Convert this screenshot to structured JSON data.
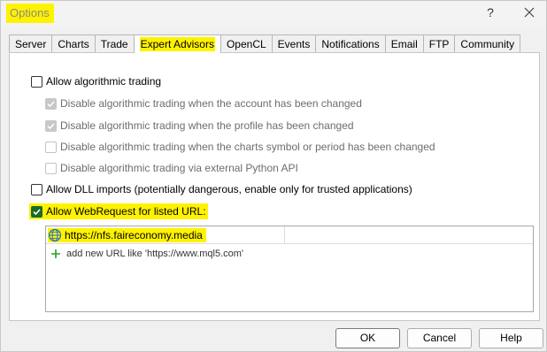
{
  "window": {
    "title": "Options",
    "help_glyph": "?",
    "close_icon": "close-icon"
  },
  "tabs": [
    {
      "label": "Server",
      "active": false
    },
    {
      "label": "Charts",
      "active": false
    },
    {
      "label": "Trade",
      "active": false
    },
    {
      "label": "Expert Advisors",
      "active": true
    },
    {
      "label": "OpenCL",
      "active": false
    },
    {
      "label": "Events",
      "active": false
    },
    {
      "label": "Notifications",
      "active": false
    },
    {
      "label": "Email",
      "active": false
    },
    {
      "label": "FTP",
      "active": false
    },
    {
      "label": "Community",
      "active": false
    }
  ],
  "options": {
    "allow_algo": {
      "label": "Allow algorithmic trading",
      "checked": false
    },
    "disable_account": {
      "label": "Disable algorithmic trading when the account has been changed",
      "checked": true,
      "disabled": true
    },
    "disable_profile": {
      "label": "Disable algorithmic trading when the profile has been changed",
      "checked": true,
      "disabled": true
    },
    "disable_symbol": {
      "label": "Disable algorithmic trading when the charts symbol or period has been changed",
      "checked": false,
      "disabled": true
    },
    "disable_python": {
      "label": "Disable algorithmic trading via external Python API",
      "checked": false,
      "disabled": true
    },
    "allow_dll": {
      "label": "Allow DLL imports (potentially dangerous, enable only for trusted applications)",
      "checked": false
    },
    "allow_webrequest": {
      "label": "Allow WebRequest for listed URL:",
      "checked": true
    }
  },
  "url_list": {
    "urls": [
      "https://nfs.faireconomy.media"
    ],
    "add_hint": "add new URL like 'https://www.mql5.com'"
  },
  "buttons": {
    "ok": "OK",
    "cancel": "Cancel",
    "help": "Help"
  },
  "colors": {
    "highlight": "#fff200",
    "check_active": "#1a6a2a",
    "plus_green": "#2a9d2a",
    "globe_blue": "#1f6fd6"
  }
}
